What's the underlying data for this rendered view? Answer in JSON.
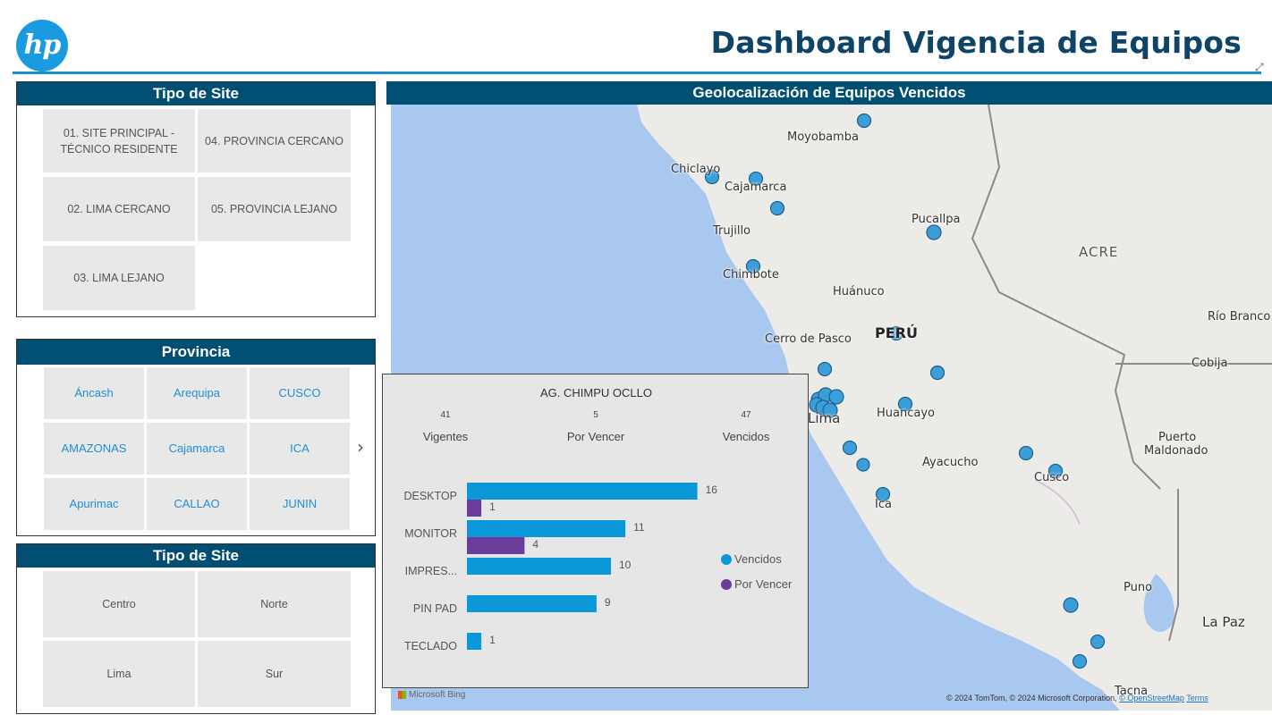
{
  "header": {
    "logo_text": "hp",
    "title": "Dashboard Vigencia de Equipos",
    "expand_icon": "expand-icon"
  },
  "tipo_site_1": {
    "title": "Tipo de Site",
    "items": [
      "01. SITE PRINCIPAL - TÉCNICO RESIDENTE",
      "04. PROVINCIA CERCANO",
      "02. LIMA CERCANO",
      "05. PROVINCIA LEJANO",
      "03. LIMA LEJANO"
    ]
  },
  "provincia": {
    "title": "Provincia",
    "items": [
      "Áncash",
      "Arequipa",
      "CUSCO",
      "AMAZONAS",
      "Cajamarca",
      "ICA",
      "Apurimac",
      "CALLAO",
      "JUNIN"
    ],
    "next_icon": "chevron-right-icon"
  },
  "tipo_site_2": {
    "title": "Tipo de Site",
    "items": [
      "Centro",
      "Norte",
      "Lima",
      "Sur"
    ]
  },
  "map": {
    "title": "Geolocalización de Equipos Vencidos",
    "colors": {
      "water": "#a9c8ef",
      "land": "#ecebe7",
      "marker": "#3a9fd8",
      "marker_stroke": "#1f5f8c"
    },
    "labels": {
      "moyobamba": "Moyobamba",
      "chiclayo": "Chiclayo",
      "cajamarca": "Cajamarca",
      "trujillo": "Trujillo",
      "chimbote": "Chimbote",
      "pucallpa": "Pucallpa",
      "acre": "ACRE",
      "huanuco": "Huánuco",
      "cerro": "Cerro de Pasco",
      "peru": "PERÚ",
      "rio_branco": "Río Branco",
      "cobija": "Cobija",
      "huancayo": "Huancayo",
      "lima": "Lima",
      "ayacucho": "Ayacucho",
      "puerto": "Puerto",
      "maldonado": "Maldonado",
      "cusco": "Cusco",
      "ica": "Ica",
      "puno": "Puno",
      "la_paz": "La Paz",
      "tacna": "Tacna"
    },
    "bing_label": "Microsoft Bing",
    "attribution": "© 2024 TomTom, © 2024 Microsoft Corporation, ",
    "osm_link": "© OpenStreetMap",
    "terms_link": "Terms"
  },
  "tooltip": {
    "title": "AG. CHIMPU OCLLO",
    "kpis": [
      {
        "value": "41",
        "label": "Vigentes"
      },
      {
        "value": "5",
        "label": "Por Vencer"
      },
      {
        "value": "47",
        "label": "Vencidos"
      }
    ],
    "legend": [
      {
        "label": "Vencidos",
        "color": "#0a98d8"
      },
      {
        "label": "Por Vencer",
        "color": "#6b3d9a"
      }
    ]
  },
  "chart_data": {
    "type": "bar",
    "orientation": "horizontal",
    "categories": [
      "DESKTOP",
      "MONITOR",
      "IMPRES...",
      "PIN PAD",
      "TECLADO"
    ],
    "series": [
      {
        "name": "Vencidos",
        "values": [
          16,
          11,
          10,
          9,
          1
        ],
        "color": "#0a98d8"
      },
      {
        "name": "Por Vencer",
        "values": [
          1,
          4,
          null,
          null,
          null
        ],
        "color": "#6b3d9a"
      }
    ],
    "xlim": [
      0,
      16
    ],
    "legend_position": "right",
    "grid": false
  }
}
